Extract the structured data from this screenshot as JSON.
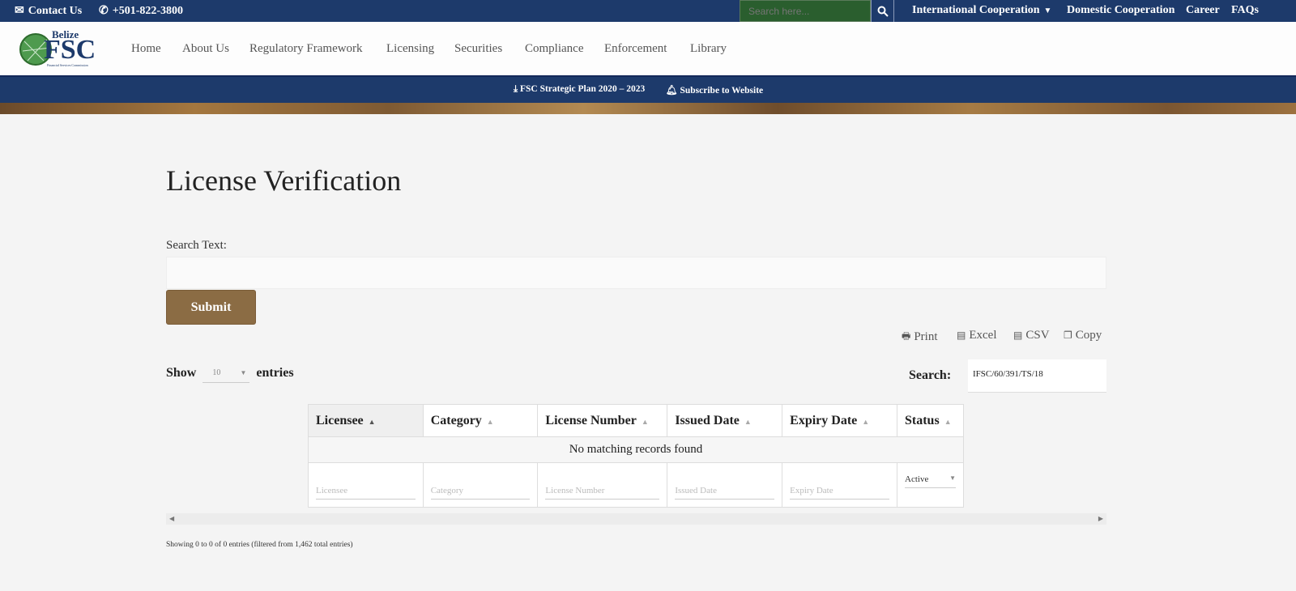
{
  "topbar": {
    "contact": "Contact Us",
    "phone": "+501-822-3800",
    "search_placeholder": "Search here...",
    "links": [
      "International Cooperation",
      "Domestic Cooperation",
      "Career",
      "FAQs"
    ]
  },
  "logo": {
    "top": "Belize",
    "main": "FSC",
    "sub": "Financial Services Commission"
  },
  "nav": [
    "Home",
    "About Us",
    "Regulatory Framework",
    "Licensing",
    "Securities",
    "Compliance",
    "Enforcement",
    "Library"
  ],
  "strip": {
    "plan": "FSC Strategic Plan 2020 – 2023",
    "subscribe": "Subscribe to Website"
  },
  "page": {
    "title": "License Verification",
    "search_label": "Search Text:",
    "search_value": "",
    "submit": "Submit"
  },
  "export": [
    "Print",
    "Excel",
    "CSV",
    "Copy"
  ],
  "table_controls": {
    "show": "Show",
    "length": "10",
    "entries": "entries",
    "search_label": "Search:",
    "search_value": "IFSC/60/391/TS/18"
  },
  "table": {
    "columns": [
      "Licensee",
      "Category",
      "License Number",
      "Issued Date",
      "Expiry Date",
      "Status"
    ],
    "empty": "No matching records found",
    "filters": [
      "Licensee",
      "Category",
      "License Number",
      "Issued Date",
      "Expiry Date"
    ],
    "status_filter": "Active"
  },
  "footer": {
    "info": "Showing 0 to 0 of 0 entries (filtered from 1,462 total entries)"
  },
  "colors": {
    "navy": "#1d3a6b",
    "green": "#2a5e2e",
    "submit": "#8b6c44"
  }
}
